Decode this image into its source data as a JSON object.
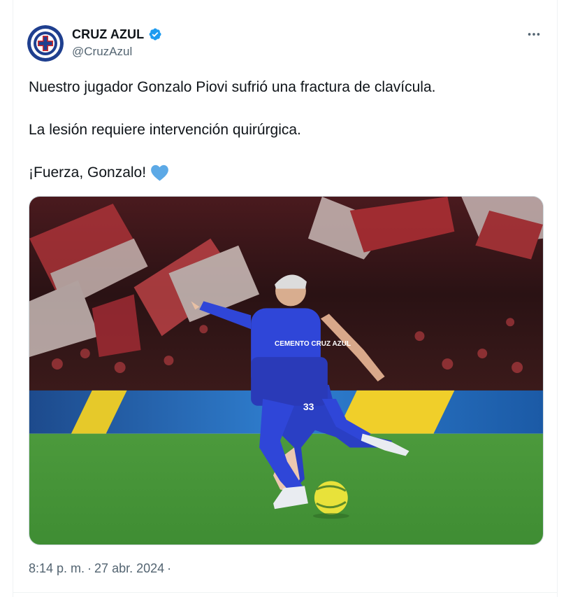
{
  "account": {
    "display_name": "CRUZ AZUL",
    "handle": "@CruzAzul",
    "verified": true,
    "avatar_icon": "cruz-azul-crest-icon"
  },
  "tweet": {
    "paragraphs": [
      "Nuestro jugador Gonzalo Piovi sufrió una fractura de clavícula.",
      "La lesión requiere intervención quirúrgica.",
      "¡Fuerza, Gonzalo!"
    ],
    "emoji": "blue-heart-icon"
  },
  "media": {
    "alt_icon": "soccer-player-photo",
    "jersey_number": "33",
    "sponsor": "CEMENTO CRUZ AZUL"
  },
  "meta": {
    "time": "8:14 p. m.",
    "separator": "·",
    "date": "27 abr. 2024",
    "trailing_separator": "·"
  },
  "colors": {
    "brand_blue": "#1d9bf0",
    "text": "#0f1419",
    "secondary_text": "#536471",
    "heart_blue": "#5ca9e6"
  }
}
